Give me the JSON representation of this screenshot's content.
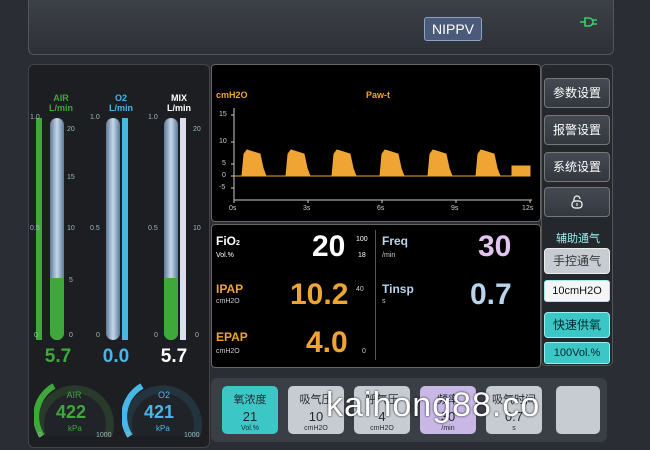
{
  "header": {
    "mode": "NIPPV",
    "plug_icon": "plug-icon"
  },
  "flowmeters": [
    {
      "name": "AIR",
      "unit": "L/min",
      "color": "#3fa83b",
      "value": "5.7",
      "fill": 0.28
    },
    {
      "name": "O2",
      "unit": "L/min",
      "color": "#4ab6e8",
      "value": "0.0",
      "fill": 0.0
    },
    {
      "name": "MIX",
      "unit": "L/min",
      "color": "#ffffff",
      "value": "5.7",
      "fill": 0.28
    }
  ],
  "flow_scale": {
    "left": [
      "1.0",
      "0.5",
      "0"
    ],
    "right": [
      "20",
      "15",
      "10",
      "5",
      "0"
    ]
  },
  "pressure_gauges": [
    {
      "name": "AIR",
      "value": "422",
      "unit": "kPa",
      "min": "0",
      "max": "1000",
      "level": 0.42
    },
    {
      "name": "O2",
      "value": "421",
      "unit": "kPa",
      "min": "0",
      "max": "1000",
      "level": 0.42
    }
  ],
  "waveform": {
    "unit": "cmH2O",
    "title": "Paw-t",
    "y_ticks": [
      "15",
      "10",
      "5",
      "0",
      "-5"
    ],
    "x_ticks": [
      "0s",
      "3s",
      "6s",
      "9s",
      "12s"
    ],
    "color": "#f0a434"
  },
  "params": {
    "fio2": {
      "label": "FiO",
      "sub": "2",
      "unit": "Vol.%",
      "value": "20",
      "hi": "100",
      "lo": "18"
    },
    "freq": {
      "label": "Freq",
      "unit": "/min",
      "value": "30"
    },
    "ipap": {
      "label": "IPAP",
      "unit": "cmH2O",
      "value": "10.2",
      "hi": "40"
    },
    "tinsp": {
      "label": "Tinsp",
      "unit": "s",
      "value": "0.7"
    },
    "epap": {
      "label": "EPAP",
      "unit": "cmH2O",
      "value": "4.0",
      "lo": "0"
    }
  },
  "menu": {
    "params": "参数设置",
    "alarm": "报警设置",
    "system": "系统设置",
    "lock_icon": "lock-icon",
    "assist_title": "辅助通气",
    "manual": "手控通气",
    "manual_value": "10cmH2O",
    "quick_o2": "快速供氧",
    "quick_o2_value": "100Vol.%"
  },
  "tiles": [
    {
      "label": "氧浓度",
      "value": "21",
      "unit": "Vol.%",
      "color": "#3cc6c6"
    },
    {
      "label": "吸气压",
      "value": "10",
      "unit": "cmH2O",
      "color": "#c7ccd2"
    },
    {
      "label": "呼气压",
      "value": "4",
      "unit": "cmH2O",
      "color": "#c7ccd2"
    },
    {
      "label": "频率",
      "value": "30",
      "unit": "/min",
      "color": "#c9b8e6"
    },
    {
      "label": "吸气时间",
      "value": "0.7",
      "unit": "s",
      "color": "#c7ccd2"
    }
  ],
  "watermark": "kaihong88.co"
}
